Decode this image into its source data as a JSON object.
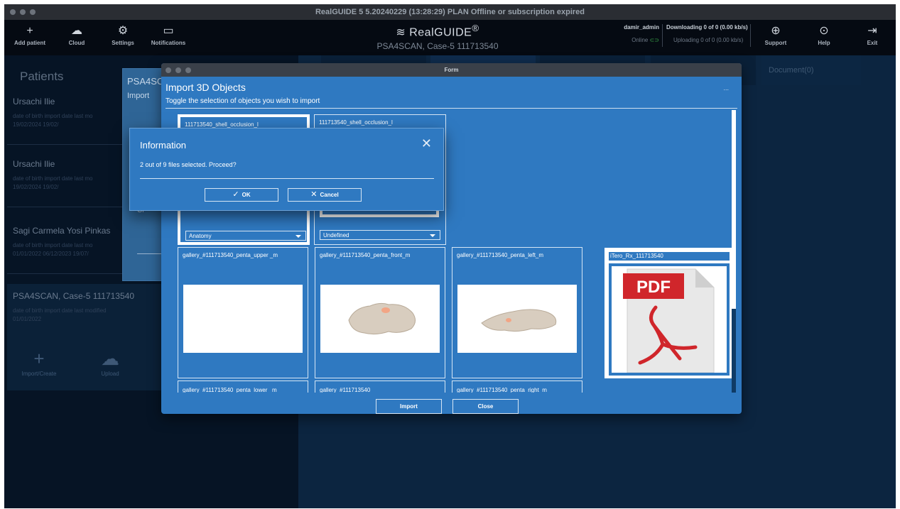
{
  "window": {
    "title": "RealGUIDE 5  5.20240229 (13:28:29)  PLAN Offline or subscription expired"
  },
  "toolbar": {
    "items": [
      {
        "label": "Add patient",
        "icon": "plus-icon"
      },
      {
        "label": "Cloud",
        "icon": "cloud-icon"
      },
      {
        "label": "Settings",
        "icon": "gear-icon"
      },
      {
        "label": "Notifications",
        "icon": "chat-icon"
      }
    ],
    "brand": "RealGUIDE",
    "brand_mark": "®",
    "case_title": "PSA4SCAN, Case-5 111713540",
    "user": "damir_admin",
    "online": "Online",
    "downloading": "Downloading 0 of 0 (0.00 kb/s)",
    "uploading": "Uploading 0 of 0 (0.00 kb/s)",
    "right_items": [
      {
        "label": "Support",
        "icon": "globe-icon"
      },
      {
        "label": "Help",
        "icon": "help-icon"
      },
      {
        "label": "Exit",
        "icon": "exit-icon"
      }
    ]
  },
  "patients": {
    "title": "Patients",
    "headers": "date of birth    import date    last mo",
    "list": [
      {
        "name": "Ursachi  Ilie",
        "values": "                  19/02/2024   19/02/"
      },
      {
        "name": "Ursachi  Ilie",
        "values": "                  19/02/2024   19/02/"
      },
      {
        "name": "Sagi Carmela Yosi Pinkas",
        "values": "01/01/2022   06/12/2023   19/07/"
      },
      {
        "name": "PSA4SCAN, Case-5  111713540",
        "headers": "date of birth       import date       last modified",
        "values": "01/01/2022"
      }
    ],
    "actions": [
      {
        "label": "Import/Create",
        "icon": "plus-icon"
      },
      {
        "label": "Upload",
        "icon": "cloud-icon"
      }
    ]
  },
  "behind_dialog": {
    "title": "PSA4SCA",
    "subtitle": "Import",
    "label": "Cr"
  },
  "right_tab": {
    "document": "Document(0)"
  },
  "form": {
    "window_title": "Form",
    "heading": "Import 3D Objects",
    "subheading": "Toggle the selection of objects you wish to import",
    "dots": "...",
    "tiles": [
      {
        "name": "111713540_shell_occlusion_l",
        "dropdown": "Anatomy",
        "selected": true
      },
      {
        "name": "111713540_shell_occlusion_l",
        "dropdown": "Undefined",
        "selected": false
      },
      {
        "name": "gallery_#111713540_penta_upper _m"
      },
      {
        "name": "gallery_#111713540_penta_front_m"
      },
      {
        "name": "gallery_#111713540_penta_left_m"
      },
      {
        "name": "iTero_Rx_111713540",
        "badge": "PDF"
      },
      {
        "name": "gallery_#111713540_penta_lower _m"
      },
      {
        "name": "gallery_#111713540"
      },
      {
        "name": "gallery_#111713540_penta_right_m"
      }
    ],
    "import_label": "Import",
    "close_label": "Close"
  },
  "info": {
    "title": "Information",
    "message": "2 out of 9 files selected. Proceed?",
    "ok_label": "OK",
    "cancel_label": "Cancel"
  },
  "colors": {
    "dialog_blue": "#2f79c1",
    "app_dark": "#0a1a2e",
    "pdf_red": "#d0262b"
  }
}
